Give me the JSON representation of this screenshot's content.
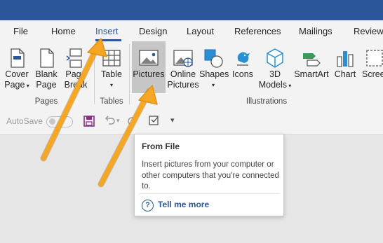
{
  "tabs": [
    "File",
    "Home",
    "Insert",
    "Design",
    "Layout",
    "References",
    "Mailings",
    "Review"
  ],
  "active_tab": "Insert",
  "ribbon": {
    "pages": {
      "cover_page": [
        "Cover",
        "Page"
      ],
      "blank_page": [
        "Blank",
        "Page"
      ],
      "page_break": [
        "Page",
        "Break"
      ],
      "group_label": "Pages"
    },
    "tables": {
      "table": "Table",
      "group_label": "Tables"
    },
    "illustrations": {
      "pictures": "Pictures",
      "online_pictures": [
        "Online",
        "Pictures"
      ],
      "shapes": "Shapes",
      "icons": "Icons",
      "models_3d": [
        "3D",
        "Models"
      ],
      "smartart": "SmartArt",
      "chart": "Chart",
      "screenshot": "Screens",
      "group_label": "Illustrations"
    }
  },
  "qat": {
    "autosave_label": "AutoSave"
  },
  "tooltip": {
    "title": "From File",
    "body": "Insert pictures from your computer or other computers that you're connected to.",
    "help_link": "Tell me more",
    "help_icon": "?"
  },
  "colors": {
    "title_bar": "#2b579a",
    "accent": "#2b579a",
    "arrow": "#f5a623"
  }
}
